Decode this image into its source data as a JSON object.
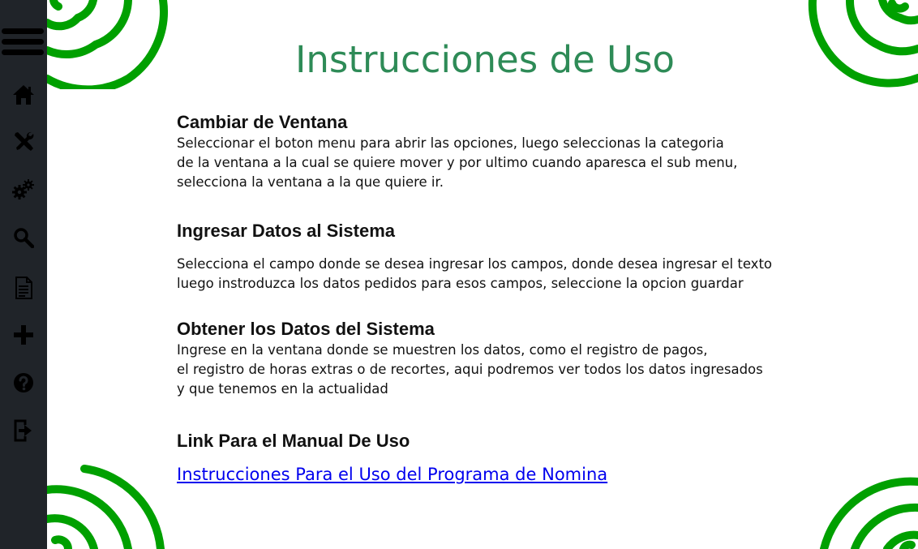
{
  "colors": {
    "sidebar_bg": "#202429",
    "icon_color": "#000000",
    "title_color": "#2e8b57",
    "spiral_color": "#00a000",
    "link_color": "#0000ee"
  },
  "sidebar": {
    "items": [
      {
        "icon": "menu-icon"
      },
      {
        "icon": "home-icon"
      },
      {
        "icon": "tools-icon"
      },
      {
        "icon": "gears-icon"
      },
      {
        "icon": "search-icon"
      },
      {
        "icon": "document-icon"
      },
      {
        "icon": "plus-icon"
      },
      {
        "icon": "help-icon"
      },
      {
        "icon": "logout-icon"
      }
    ]
  },
  "page": {
    "title": "Instrucciones de Uso"
  },
  "sections": [
    {
      "heading": "Cambiar de Ventana",
      "lines": [
        "Seleccionar el boton menu para abrir las opciones, luego seleccionas la categoria",
        "de la ventana a la cual se quiere mover y por ultimo cuando aparesca el sub menu,",
        "selecciona la ventana a la que quiere ir."
      ]
    },
    {
      "heading": "Ingresar Datos al Sistema",
      "lines": [
        "Selecciona el campo donde se desea ingresar los campos, donde desea ingresar el texto",
        "luego instroduzca los datos pedidos para esos campos, seleccione la opcion guardar"
      ]
    },
    {
      "heading": "Obtener los Datos del Sistema",
      "lines": [
        "Ingrese en la ventana donde se muestren los datos, como el registro de pagos,",
        "el registro de horas extras o de recortes, aqui podremos ver todos los datos ingresados",
        "y que tenemos en la actualidad"
      ]
    },
    {
      "heading": "Link Para el Manual De Uso",
      "link": "Instrucciones Para el Uso del Programa de Nomina"
    }
  ]
}
